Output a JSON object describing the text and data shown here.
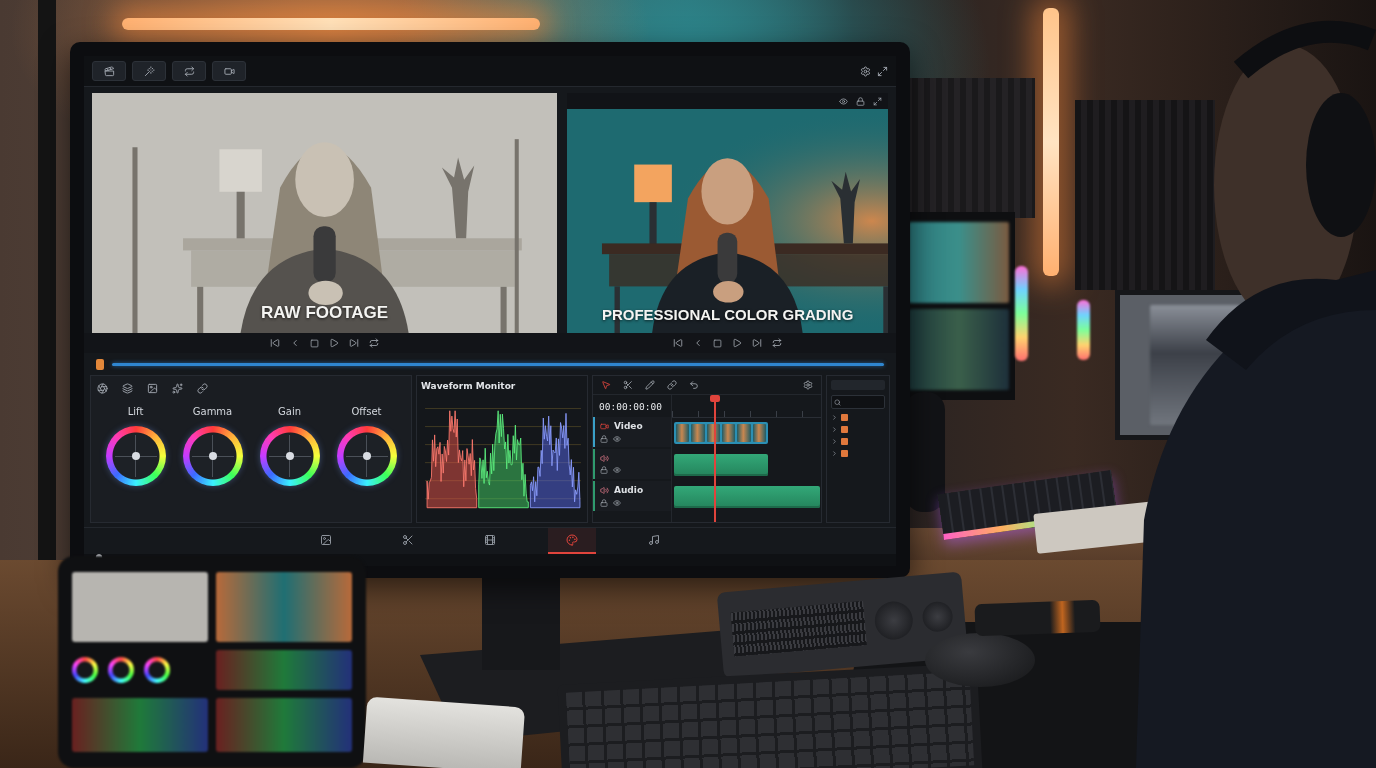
{
  "viewer": {
    "panes": [
      {
        "kind": "raw",
        "caption": "RAW FOOTAGE"
      },
      {
        "kind": "graded",
        "caption": "PROFESSIONAL COLOR GRADING"
      }
    ]
  },
  "color_wheels": [
    {
      "label": "Lift"
    },
    {
      "label": "Gamma"
    },
    {
      "label": "Gain"
    },
    {
      "label": "Offset"
    }
  ],
  "waveform": {
    "title": "Waveform Monitor"
  },
  "timeline": {
    "timecode": "00:00:00:00",
    "tracks": [
      {
        "kind": "video",
        "label": "Video"
      },
      {
        "kind": "audio"
      },
      {
        "kind": "audio",
        "label": "Audio"
      }
    ]
  },
  "pages": [
    {
      "kind": "media",
      "selected": false
    },
    {
      "kind": "cut",
      "selected": false
    },
    {
      "kind": "edit",
      "selected": false
    },
    {
      "kind": "color",
      "selected": true
    },
    {
      "kind": "fairlight",
      "selected": false
    }
  ]
}
